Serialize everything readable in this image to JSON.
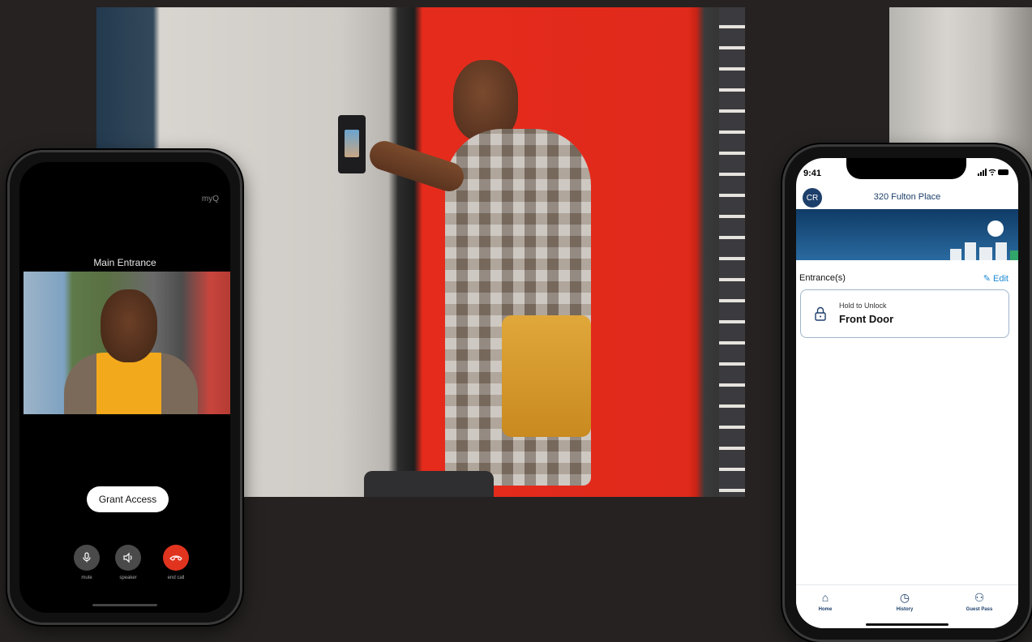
{
  "left_phone": {
    "logo": "myQ",
    "call_title": "Main Entrance",
    "grant_button": "Grant Access",
    "controls": [
      {
        "label": "mute",
        "icon": "microphone-icon",
        "color": "#4a4a4a"
      },
      {
        "label": "speaker",
        "icon": "speaker-icon",
        "color": "#4a4a4a"
      },
      {
        "label": "end call",
        "icon": "end-call-icon",
        "color": "#e1341f"
      }
    ]
  },
  "right_phone": {
    "status": {
      "time": "9:41",
      "icons": "signal-icon wifi-icon battery-icon"
    },
    "avatar": "CR",
    "property_name": "320 Fulton Place",
    "entrances_label": "Entrance(s)",
    "edit_label": "Edit",
    "door_card": {
      "hint": "Hold to Unlock",
      "name": "Front Door",
      "icon": "lock-icon"
    },
    "tabs": [
      {
        "label": "Home",
        "icon": "home-icon"
      },
      {
        "label": "History",
        "icon": "history-icon"
      },
      {
        "label": "Guest Pass",
        "icon": "guest-pass-icon"
      }
    ],
    "colors": {
      "primary": "#1d3f6b",
      "link": "#1c8ad6",
      "end_call": "#e1341f"
    }
  }
}
